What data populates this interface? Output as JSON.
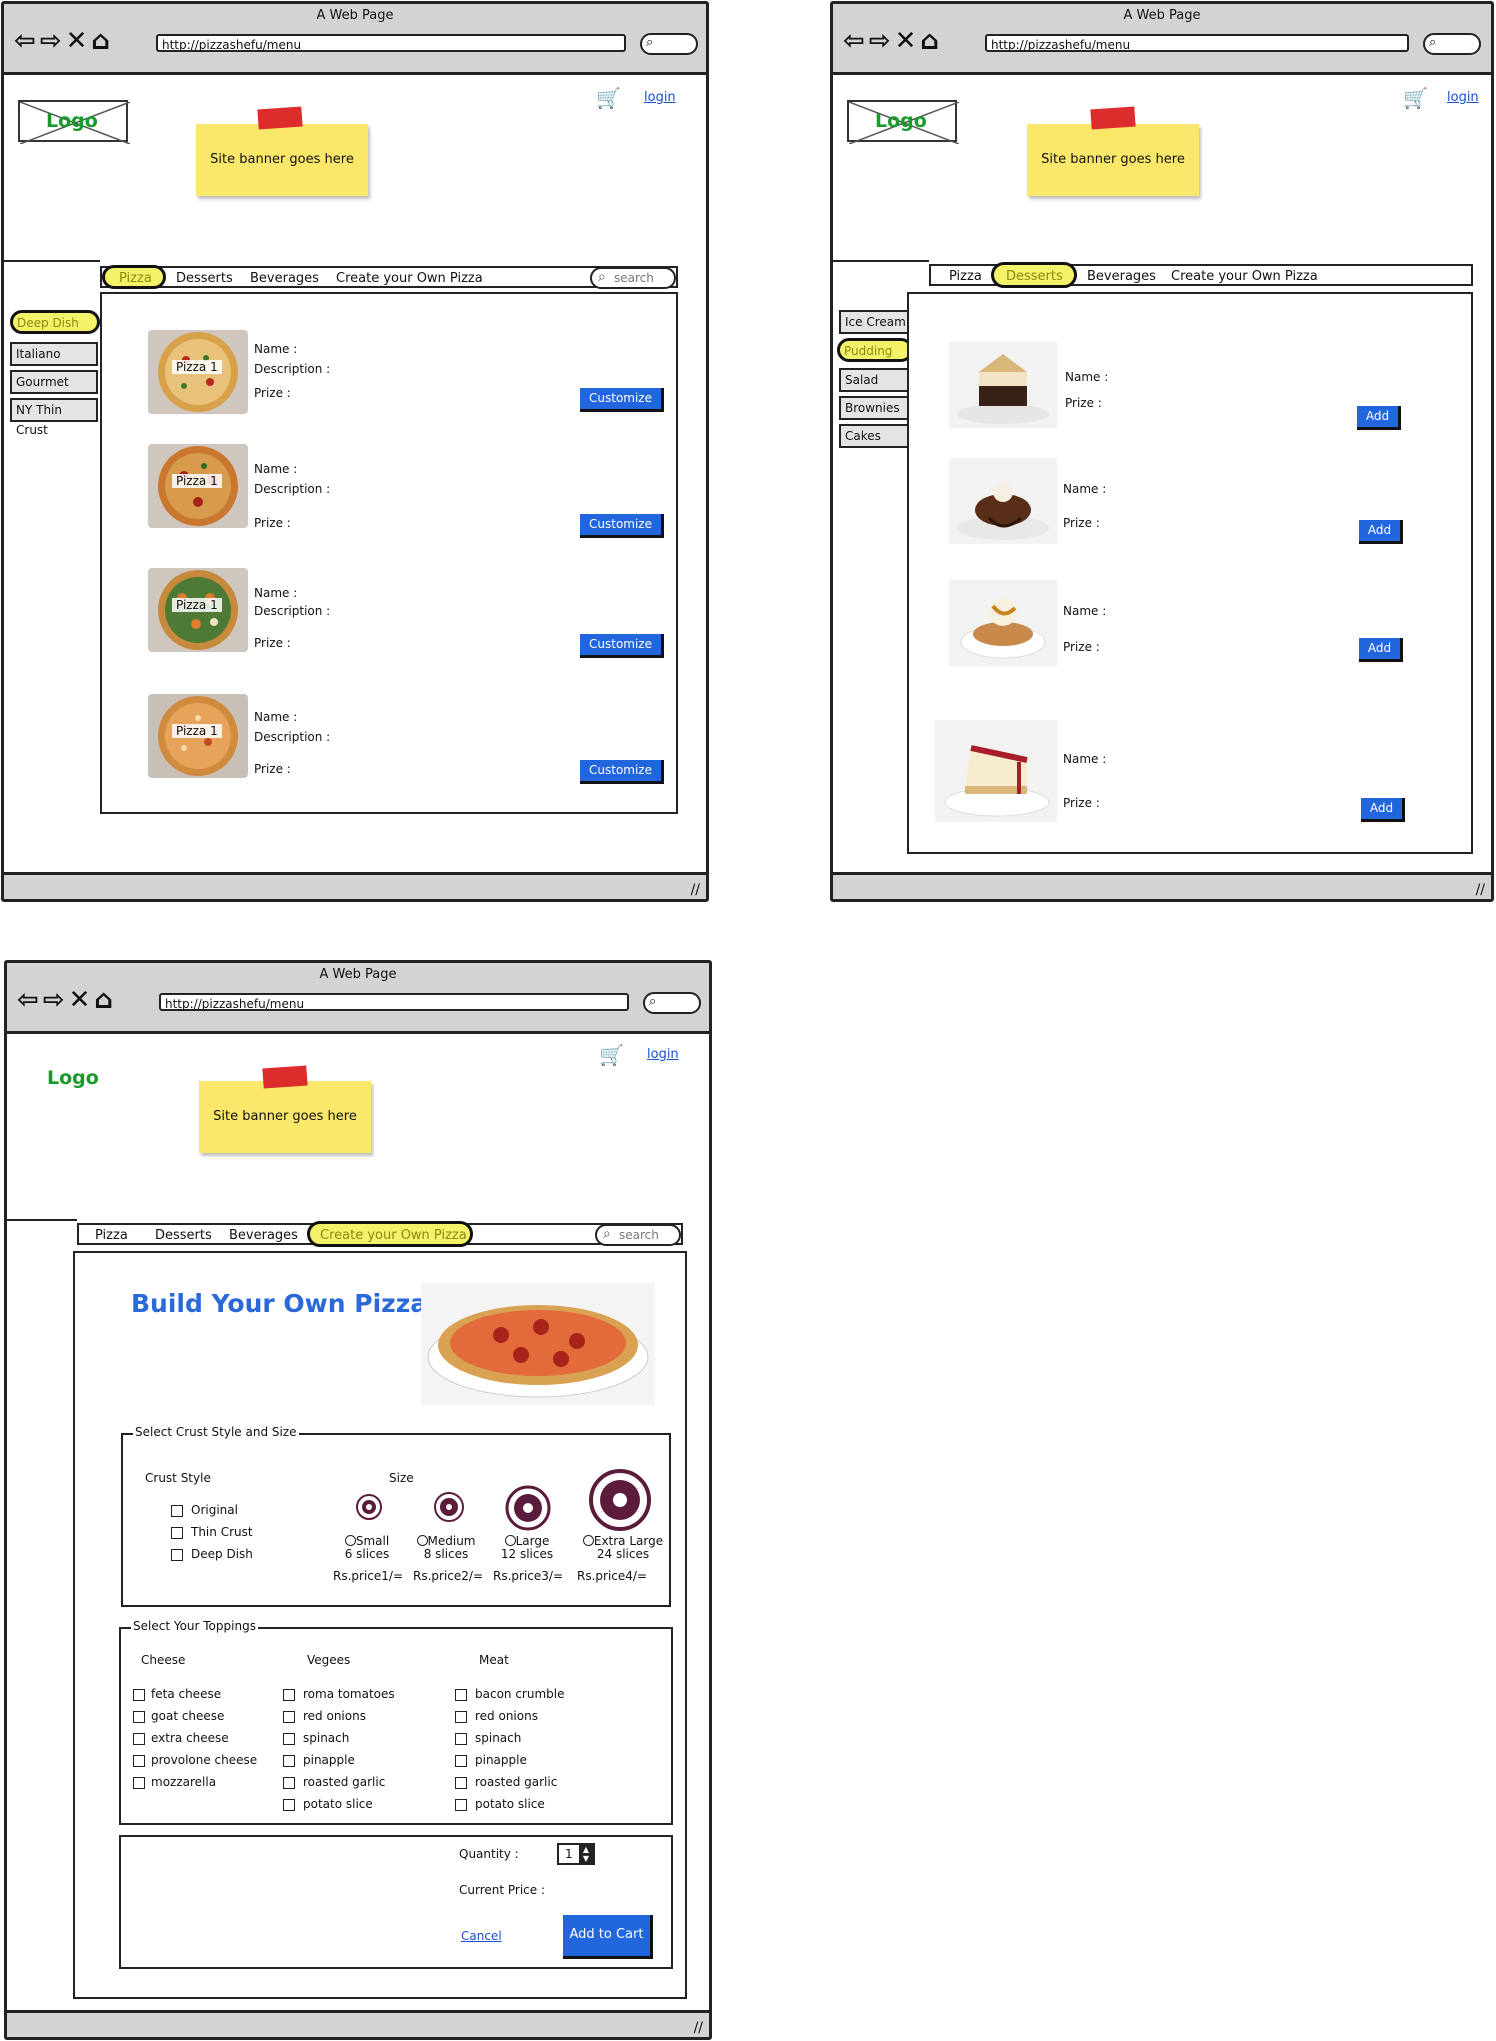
{
  "browser": {
    "title": "A Web Page",
    "url": "http://pizzashefu/menu",
    "nav_icons": "⇦⇨✕⌂"
  },
  "header": {
    "logo": "Logo",
    "banner": "Site banner goes here",
    "cart_icon": "🛒",
    "login": "login"
  },
  "menu": {
    "items": [
      "Pizza",
      "Desserts",
      "Beverages",
      "Create your Own Pizza"
    ],
    "search_placeholder": "search"
  },
  "pizza_page": {
    "sidebar": [
      "Deep Dish",
      "Italiano",
      "Gourmet",
      "NY Thin Crust"
    ],
    "items": [
      {
        "label": "Pizza 1",
        "name": "Name :",
        "description": "Description :",
        "price": "Prize :",
        "button": "Customize"
      },
      {
        "label": "Pizza 1",
        "name": "Name :",
        "description": "Description :",
        "price": "Prize :",
        "button": "Customize"
      },
      {
        "label": "Pizza 1",
        "name": "Name :",
        "description": "Description :",
        "price": "Prize :",
        "button": "Customize"
      },
      {
        "label": "Pizza 1",
        "name": "Name :",
        "description": "Description :",
        "price": "Prize :",
        "button": "Customize"
      }
    ]
  },
  "dessert_page": {
    "sidebar": [
      "Ice Cream",
      "Pudding",
      "Salad",
      "Brownies",
      "Cakes"
    ],
    "items": [
      {
        "name": "Name :",
        "price": "Prize :",
        "button": "Add"
      },
      {
        "name": "Name :",
        "price": "Prize :",
        "button": "Add"
      },
      {
        "name": "Name :",
        "price": "Prize :",
        "button": "Add"
      },
      {
        "name": "Name :",
        "price": "Prize :",
        "button": "Add"
      }
    ]
  },
  "build_page": {
    "heading": "Build Your Own Pizza",
    "crust_group": "Select Crust Style and Size",
    "crust_style_label": "Crust Style",
    "crust_styles": [
      "Original",
      "Thin Crust",
      "Deep Dish"
    ],
    "size_label": "Size",
    "sizes": [
      {
        "name": "Small",
        "slices": "6 slices",
        "price": "Rs.price1/="
      },
      {
        "name": "Medium",
        "slices": "8 slices",
        "price": "Rs.price2/="
      },
      {
        "name": "Large",
        "slices": "12 slices",
        "price": "Rs.price3/="
      },
      {
        "name": "Extra Large",
        "slices": "24 slices",
        "price": "Rs.price4/="
      }
    ],
    "toppings_group": "Select Your Toppings",
    "cheese_label": "Cheese",
    "cheese": [
      "feta cheese",
      "goat cheese",
      "extra cheese",
      "provolone cheese",
      "mozzarella"
    ],
    "vegees_label": "Vegees",
    "vegees": [
      "roma tomatoes",
      "red onions",
      "spinach",
      "pinapple",
      "roasted garlic",
      "potato slice"
    ],
    "meat_label": "Meat",
    "meat": [
      "bacon crumble",
      "red onions",
      "spinach",
      "pinapple",
      "roasted garlic",
      "potato slice"
    ],
    "quantity_label": "Quantity :",
    "quantity_value": "1",
    "current_price_label": "Current Price :",
    "cancel": "Cancel",
    "add_to_cart": "Add to Cart"
  }
}
